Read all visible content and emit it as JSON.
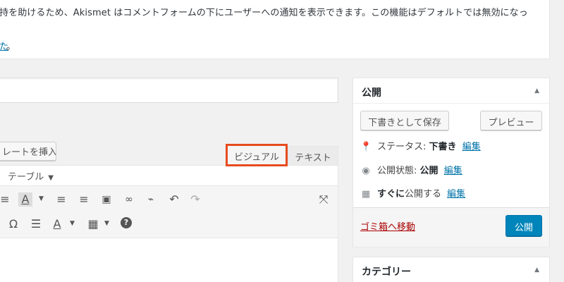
{
  "notice": {
    "line1": "持を助けるため、Akismet はコメントフォームの下にユーザーへの通知を表示できます。この機能はデフォルトでは無効になっ",
    "link_fragment": "た",
    "trailing": "。"
  },
  "editor": {
    "insert_button_label": "レートを挿入",
    "tabs": {
      "visual": "ビジュアル",
      "text": "テキスト"
    },
    "menu": {
      "table_label": "テーブル"
    },
    "toolbar_row1": [
      {
        "name": "align-left-icon",
        "glyph": "≡"
      },
      {
        "name": "text-color-icon",
        "glyph": "A"
      },
      {
        "name": "align-center-icon",
        "glyph": "≡"
      },
      {
        "name": "align-right-icon",
        "glyph": "≡"
      },
      {
        "name": "image-icon",
        "glyph": "▣"
      },
      {
        "name": "link-icon",
        "glyph": "🔗"
      },
      {
        "name": "unlink-icon",
        "glyph": "⛓"
      },
      {
        "name": "undo-icon",
        "glyph": "↶"
      },
      {
        "name": "redo-icon",
        "glyph": "↷"
      },
      {
        "name": "fullscreen-icon",
        "glyph": "⤢"
      }
    ],
    "toolbar_row2": [
      {
        "name": "special-char-icon",
        "glyph": "Ω"
      },
      {
        "name": "horizontal-line-icon",
        "glyph": "☰"
      },
      {
        "name": "text-color-2-icon",
        "glyph": "A"
      },
      {
        "name": "table-icon",
        "glyph": "▦"
      },
      {
        "name": "help-icon",
        "glyph": "?"
      }
    ]
  },
  "publish": {
    "title": "公開",
    "toggle_icon": "▲",
    "save_draft": "下書きとして保存",
    "preview": "プレビュー",
    "status_label": "ステータス:",
    "status_value": "下書き",
    "visibility_label": "公開状態:",
    "visibility_value": "公開",
    "schedule_value": "すぐに",
    "schedule_suffix": "公開する",
    "edit_link": "編集",
    "trash": "ゴミ箱へ移動",
    "publish_button": "公開"
  },
  "category": {
    "title": "カテゴリー",
    "toggle_icon": "▲"
  },
  "colors": {
    "accent": "#0085ba",
    "highlight_border": "#e64c1f",
    "link": "#0073aa",
    "trash": "#aa0000"
  }
}
